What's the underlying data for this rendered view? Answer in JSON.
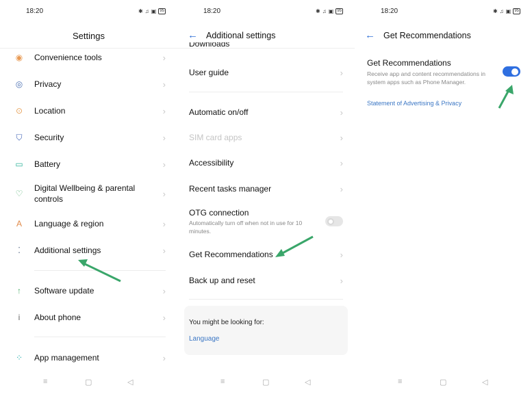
{
  "status_bar": {
    "time": "18:20",
    "icons": [
      "bluetooth-icon",
      "bell-off-icon",
      "nfc-icon",
      "battery-icon"
    ],
    "battery": "95"
  },
  "screen1": {
    "title": "Settings",
    "items": [
      {
        "label": "Convenience tools",
        "icon": "convenience-tools-icon",
        "glyph": "◉",
        "color": "#e89a54"
      },
      {
        "label": "Privacy",
        "icon": "privacy-eye-lock-icon",
        "glyph": "◎",
        "color": "#4a6fb2"
      },
      {
        "label": "Location",
        "icon": "location-pin-icon",
        "glyph": "⊙",
        "color": "#e7a25a"
      },
      {
        "label": "Security",
        "icon": "shield-icon",
        "glyph": "⛉",
        "color": "#3f62b5"
      },
      {
        "label": "Battery",
        "icon": "battery-icon",
        "glyph": "▭",
        "color": "#2fb39a"
      },
      {
        "label": "Digital Wellbeing & parental controls",
        "icon": "wellbeing-heart-icon",
        "glyph": "♡",
        "color": "#4cae6a"
      },
      {
        "label": "Language & region",
        "icon": "language-a-icon",
        "glyph": "A",
        "color": "#e08a4a"
      },
      {
        "label": "Additional settings",
        "icon": "additional-dots-icon",
        "glyph": "⁚",
        "color": "#5b6f8c"
      },
      {
        "label": "Software update",
        "icon": "software-update-arrow-icon",
        "glyph": "↑",
        "color": "#4cae6a"
      },
      {
        "label": "About phone",
        "icon": "info-icon",
        "glyph": "i",
        "color": "#666"
      },
      {
        "label": "App management",
        "icon": "app-grid-icon",
        "glyph": "⁘",
        "color": "#2ab0b0"
      }
    ]
  },
  "screen2": {
    "title": "Additional settings",
    "partial_item": "Downloads",
    "items": [
      {
        "label": "User guide"
      },
      {
        "label": "Automatic on/off"
      },
      {
        "label": "SIM card apps",
        "disabled": true
      },
      {
        "label": "Accessibility"
      },
      {
        "label": "Recent tasks manager"
      },
      {
        "label": "OTG connection",
        "sub": "Automatically turn off when not in use for 10 minutes.",
        "toggle": false
      },
      {
        "label": "Get Recommendations"
      },
      {
        "label": "Back up and reset"
      }
    ],
    "suggest": {
      "heading": "You might be looking for:",
      "link": "Language"
    }
  },
  "screen3": {
    "title": "Get Recommendations",
    "setting": {
      "label": "Get Recommendations",
      "sub": "Receive app and content recommendations in system apps such as Phone Manager.",
      "enabled": true
    },
    "link": "Statement of Advertising & Privacy"
  },
  "colors": {
    "accent": "#2f6fd6",
    "arrow": "#3aa66a",
    "toggle_on": "#2f6fe0",
    "toggle_off": "#e6e6e6"
  },
  "navbar": {
    "menu": "≡",
    "home": "▢",
    "back": "◁"
  }
}
